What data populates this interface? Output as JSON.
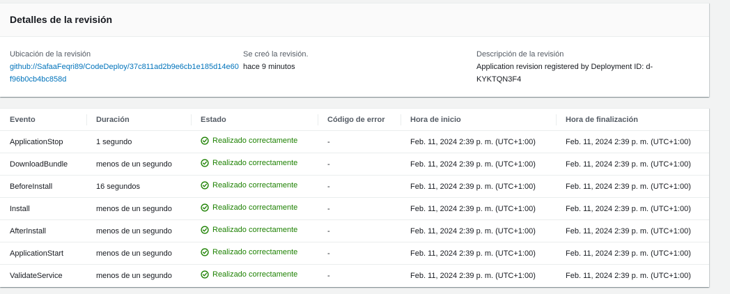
{
  "details": {
    "title": "Detalles de la revisión",
    "location_label": "Ubicación de la revisión",
    "location_value": "github://SafaaFeqri89/CodeDeploy/37c811ad2b9e6cb1e185d14e60f96b0cb4bc858d",
    "created_label": "Se creó la revisión.",
    "created_value": "hace 9 minutos",
    "description_label": "Descripción de la revisión",
    "description_value": "Application revision registered by Deployment ID: d-KYKTQN3F4"
  },
  "events_table": {
    "columns": [
      "Evento",
      "Duración",
      "Estado",
      "Código de error",
      "Hora de inicio",
      "Hora de finalización"
    ],
    "rows": [
      {
        "event": "ApplicationStop",
        "duration": "1 segundo",
        "status": "Realizado correctamente",
        "error_code": "-",
        "start": "Feb. 11, 2024 2:39 p. m. (UTC+1:00)",
        "end": "Feb. 11, 2024 2:39 p. m. (UTC+1:00)"
      },
      {
        "event": "DownloadBundle",
        "duration": "menos de un segundo",
        "status": "Realizado correctamente",
        "error_code": "-",
        "start": "Feb. 11, 2024 2:39 p. m. (UTC+1:00)",
        "end": "Feb. 11, 2024 2:39 p. m. (UTC+1:00)"
      },
      {
        "event": "BeforeInstall",
        "duration": "16 segundos",
        "status": "Realizado correctamente",
        "error_code": "-",
        "start": "Feb. 11, 2024 2:39 p. m. (UTC+1:00)",
        "end": "Feb. 11, 2024 2:39 p. m. (UTC+1:00)"
      },
      {
        "event": "Install",
        "duration": "menos de un segundo",
        "status": "Realizado correctamente",
        "error_code": "-",
        "start": "Feb. 11, 2024 2:39 p. m. (UTC+1:00)",
        "end": "Feb. 11, 2024 2:39 p. m. (UTC+1:00)"
      },
      {
        "event": "AfterInstall",
        "duration": "menos de un segundo",
        "status": "Realizado correctamente",
        "error_code": "-",
        "start": "Feb. 11, 2024 2:39 p. m. (UTC+1:00)",
        "end": "Feb. 11, 2024 2:39 p. m. (UTC+1:00)"
      },
      {
        "event": "ApplicationStart",
        "duration": "menos de un segundo",
        "status": "Realizado correctamente",
        "error_code": "-",
        "start": "Feb. 11, 2024 2:39 p. m. (UTC+1:00)",
        "end": "Feb. 11, 2024 2:39 p. m. (UTC+1:00)"
      },
      {
        "event": "ValidateService",
        "duration": "menos de un segundo",
        "status": "Realizado correctamente",
        "error_code": "-",
        "start": "Feb. 11, 2024 2:39 p. m. (UTC+1:00)",
        "end": "Feb. 11, 2024 2:39 p. m. (UTC+1:00)"
      }
    ]
  },
  "icons": {
    "status": "check-circle-icon"
  },
  "colors": {
    "success": "#1d8102",
    "link": "#0073bb"
  }
}
